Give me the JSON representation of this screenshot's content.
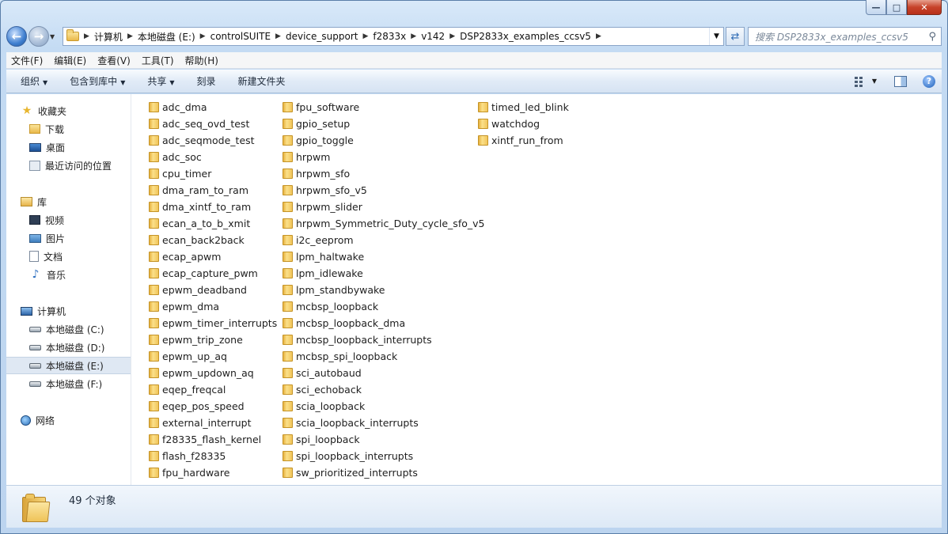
{
  "address": {
    "segments": [
      "计算机",
      "本地磁盘 (E:)",
      "controlSUITE",
      "device_support",
      "f2833x",
      "v142",
      "DSP2833x_examples_ccsv5"
    ],
    "search_placeholder": "搜索 DSP2833x_examples_ccsv5"
  },
  "menu": [
    "文件(F)",
    "编辑(E)",
    "查看(V)",
    "工具(T)",
    "帮助(H)"
  ],
  "commands": {
    "organize": "组织",
    "include_library": "包含到库中",
    "share": "共享",
    "burn": "刻录",
    "new_folder": "新建文件夹"
  },
  "sidebar": {
    "favorites": "收藏夹",
    "favorites_items": [
      "下载",
      "桌面",
      "最近访问的位置"
    ],
    "libraries": "库",
    "libraries_items": [
      "视频",
      "图片",
      "文档",
      "音乐"
    ],
    "computer": "计算机",
    "drives": [
      "本地磁盘 (C:)",
      "本地磁盘 (D:)",
      "本地磁盘 (E:)",
      "本地磁盘 (F:)"
    ],
    "selected_drive": "本地磁盘 (E:)",
    "network": "网络"
  },
  "files": {
    "col1": [
      "adc_dma",
      "adc_seq_ovd_test",
      "adc_seqmode_test",
      "adc_soc",
      "cpu_timer",
      "dma_ram_to_ram",
      "dma_xintf_to_ram",
      "ecan_a_to_b_xmit",
      "ecan_back2back",
      "ecap_apwm",
      "ecap_capture_pwm",
      "epwm_deadband",
      "epwm_dma",
      "epwm_timer_interrupts",
      "epwm_trip_zone",
      "epwm_up_aq",
      "epwm_updown_aq",
      "eqep_freqcal",
      "eqep_pos_speed",
      "external_interrupt",
      "f28335_flash_kernel",
      "flash_f28335",
      "fpu_hardware"
    ],
    "col2": [
      "fpu_software",
      "gpio_setup",
      "gpio_toggle",
      "hrpwm",
      "hrpwm_sfo",
      "hrpwm_sfo_v5",
      "hrpwm_slider",
      "hrpwm_Symmetric_Duty_cycle_sfo_v5",
      "i2c_eeprom",
      "lpm_haltwake",
      "lpm_idlewake",
      "lpm_standbywake",
      "mcbsp_loopback",
      "mcbsp_loopback_dma",
      "mcbsp_loopback_interrupts",
      "mcbsp_spi_loopback",
      "sci_autobaud",
      "sci_echoback",
      "scia_loopback",
      "scia_loopback_interrupts",
      "spi_loopback",
      "spi_loopback_interrupts",
      "sw_prioritized_interrupts"
    ],
    "col3": [
      "timed_led_blink",
      "watchdog",
      "xintf_run_from"
    ]
  },
  "details": {
    "count": "49 个对象"
  }
}
